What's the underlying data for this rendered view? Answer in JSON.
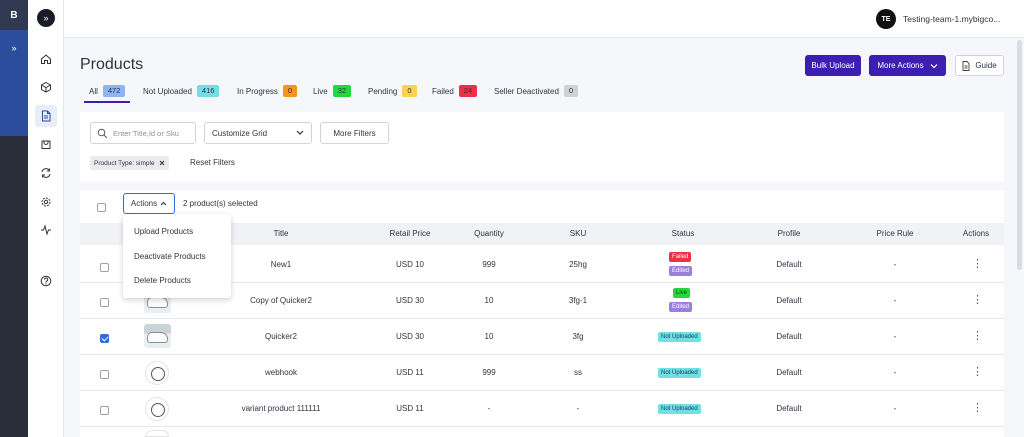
{
  "sidebar": {
    "brand": "B",
    "expand": "»",
    "collapse": "»",
    "icons": [
      "home-icon",
      "box-icon",
      "document-icon",
      "shopping-bag-icon",
      "sync-icon",
      "gear-icon",
      "activity-icon",
      "help-icon"
    ]
  },
  "header": {
    "avatar": "TE",
    "store": "Testing-team-1.mybigco..."
  },
  "page": {
    "title": "Products",
    "bulk_upload": "Bulk Upload",
    "more_actions": "More Actions",
    "guide": "Guide"
  },
  "tabs": [
    {
      "label": "All",
      "count": "472",
      "color": "#8fb4f2"
    },
    {
      "label": "Not Uploaded",
      "count": "416",
      "color": "#6ee0e6"
    },
    {
      "label": "In Progress",
      "count": "0",
      "color": "#f7941d"
    },
    {
      "label": "Live",
      "count": "32",
      "color": "#23d93a"
    },
    {
      "label": "Pending",
      "count": "0",
      "color": "#fdd24d"
    },
    {
      "label": "Failed",
      "count": "24",
      "color": "#ee2f47"
    },
    {
      "label": "Seller Deactivated",
      "count": "0",
      "color": "#cfd1d5"
    }
  ],
  "filters": {
    "search_placeholder": "Enter Title,Id or Sku",
    "customize_grid": "Customize Grid",
    "more_filters": "More Filters",
    "chip": "Product Type: simple",
    "reset": "Reset Filters"
  },
  "bulk": {
    "actions_label": "Actions",
    "selected_text": "2 product(s) selected",
    "menu": [
      "Upload Products",
      "Deactivate Products",
      "Delete Products"
    ]
  },
  "table": {
    "columns": [
      "Title",
      "Retail Price",
      "Quantity",
      "SKU",
      "Status",
      "Profile",
      "Price Rule",
      "Actions"
    ],
    "rows": [
      {
        "title": "New1",
        "price": "USD 10",
        "qty": "999",
        "sku": "25hg",
        "status": [
          "Failed",
          "Edited"
        ],
        "profile": "Default",
        "rule": "-",
        "checked": false,
        "thumb": "none"
      },
      {
        "title": "Copy of Quicker2",
        "price": "USD 30",
        "qty": "10",
        "sku": "3fg-1",
        "status": [
          "Live",
          "Edited"
        ],
        "profile": "Default",
        "rule": "-",
        "checked": false,
        "thumb": "car"
      },
      {
        "title": "Quicker2",
        "price": "USD 30",
        "qty": "10",
        "sku": "3fg",
        "status": [
          "Not Uploaded"
        ],
        "profile": "Default",
        "rule": "-",
        "checked": true,
        "thumb": "car"
      },
      {
        "title": "webhook",
        "price": "USD 11",
        "qty": "999",
        "sku": "ss",
        "status": [
          "Not Uploaded"
        ],
        "profile": "Default",
        "rule": "-",
        "checked": false,
        "thumb": "logo"
      },
      {
        "title": "variant product 111111",
        "price": "USD 11",
        "qty": "-",
        "sku": "-",
        "status": [
          "Not Uploaded"
        ],
        "profile": "Default",
        "rule": "-",
        "checked": false,
        "thumb": "logo"
      }
    ],
    "status_colors": {
      "Failed": "#ee2f47",
      "Edited": "#9b7fe0",
      "Live": "#23d93a",
      "Not Uploaded": "#6ee0e6"
    }
  }
}
